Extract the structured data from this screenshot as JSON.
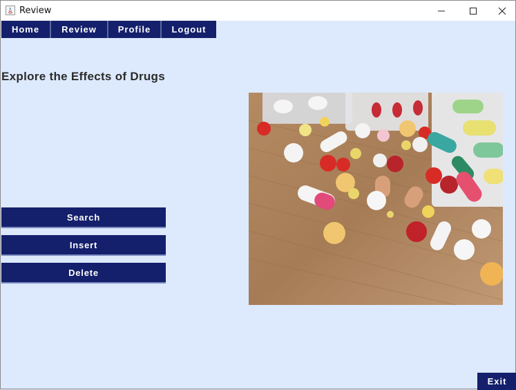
{
  "window": {
    "title": "Review"
  },
  "menu": {
    "items": [
      {
        "label": "Home"
      },
      {
        "label": "Review"
      },
      {
        "label": "Profile"
      },
      {
        "label": "Logout"
      }
    ]
  },
  "main": {
    "heading": "Explore the Effects of Drugs",
    "buttons": {
      "search": "Search",
      "insert": "Insert",
      "delete": "Delete"
    },
    "image": {
      "subject": "assorted pills and capsules on wooden table"
    }
  },
  "footer": {
    "exit_label": "Exit"
  },
  "colors": {
    "background": "#dde9fc",
    "button_navy": "#14206b",
    "button_text": "#ffffff"
  }
}
